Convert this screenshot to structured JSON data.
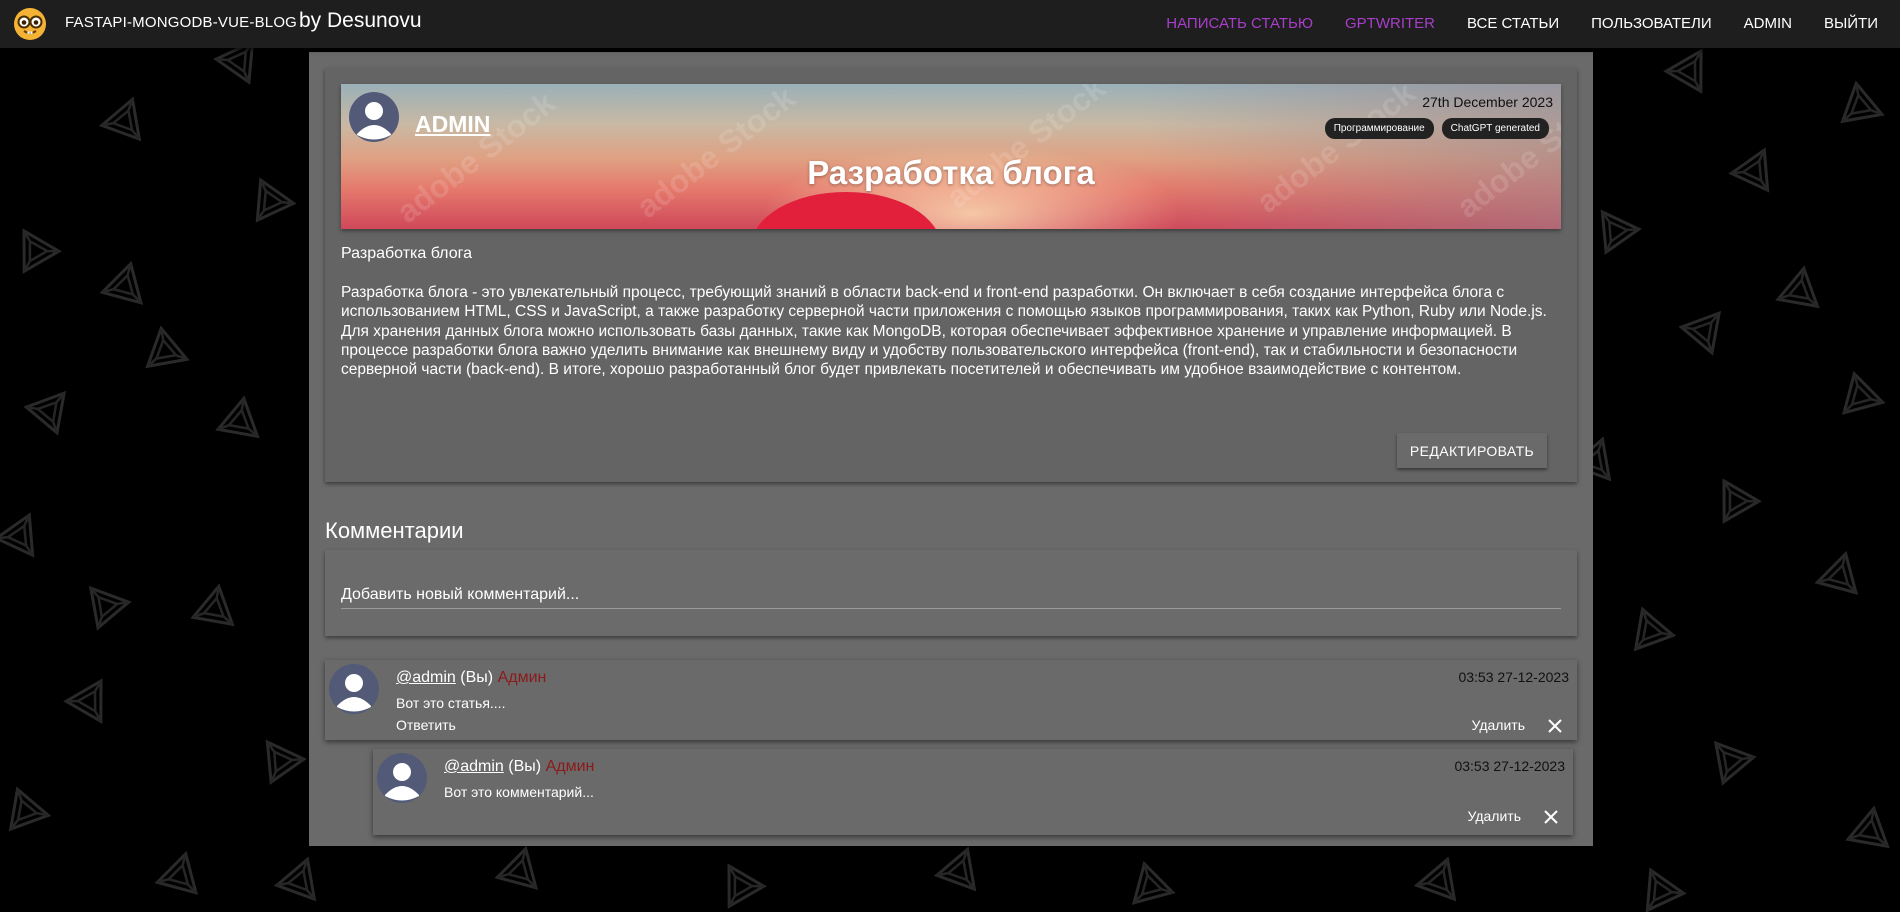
{
  "header": {
    "app_name": "FASTAPI-MONGODB-VUE-BLOG",
    "by_line": "by Desunovu",
    "nav": [
      {
        "label": "НАПИСАТЬ СТАТЬЮ",
        "color": "#a83ecb"
      },
      {
        "label": "GPTWRITER",
        "color": "#a83ecb"
      },
      {
        "label": "ВСЕ СТАТЬИ"
      },
      {
        "label": "ПОЛЬЗОВАТЕЛИ"
      },
      {
        "label": "ADMIN"
      },
      {
        "label": "ВЫЙТИ"
      }
    ]
  },
  "post": {
    "author": "ADMIN",
    "date": "27th December 2023",
    "tags": [
      "Программирование",
      "ChatGPT generated"
    ],
    "title": "Разработка блога",
    "subtitle": "Разработка блога",
    "body": "Разработка блога - это увлекательный процесс, требующий знаний в области back-end и front-end разработки. Он включает в себя создание интерфейса блога с использованием HTML, CSS и JavaScript, а также разработку серверной части приложения с помощью языков программирования, таких как Python, Ruby или Node.js. Для хранения данных блога можно использовать базы данных, такие как MongoDB, которая обеспечивает эффективное хранение и управление информацией. В процессе разработки блога важно уделить внимание как внешнему виду и удобству пользовательского интерфейса (front-end), так и стабильности и безопасности серверной части (back-end). В итоге, хорошо разработанный блог будет привлекать посетителей и обеспечивать им удобное взаимодействие с контентом.",
    "edit_label": "РЕДАКТИРОВАТЬ",
    "banner_watermark": "adobe Stock"
  },
  "comments_section": {
    "heading": "Комментарии",
    "new_comment_placeholder": "Добавить новый комментарий..."
  },
  "comments": [
    {
      "user": "@admin",
      "you": "(Вы)",
      "role": "Админ",
      "time": "03:53 27-12-2023",
      "text": "Вот это статья....",
      "reply_label": "Ответить",
      "delete_label": "Удалить"
    },
    {
      "user": "@admin",
      "you": "(Вы)",
      "role": "Админ",
      "time": "03:53 27-12-2023",
      "text": "Вот это комментарий...",
      "delete_label": "Удалить"
    }
  ],
  "colors": {
    "background": "#000000",
    "topbar": "#1e1e1e",
    "panel": "#6a6a6a",
    "accent_purple": "#a83ecb",
    "role_red": "#8b1a1a",
    "tag_bg": "#222222"
  },
  "icons": {
    "logo": "nerd-face-icon",
    "avatar": "default-user-avatar-icon",
    "close": "close-x-icon",
    "background_pattern": "penrose-triangle-icon"
  }
}
